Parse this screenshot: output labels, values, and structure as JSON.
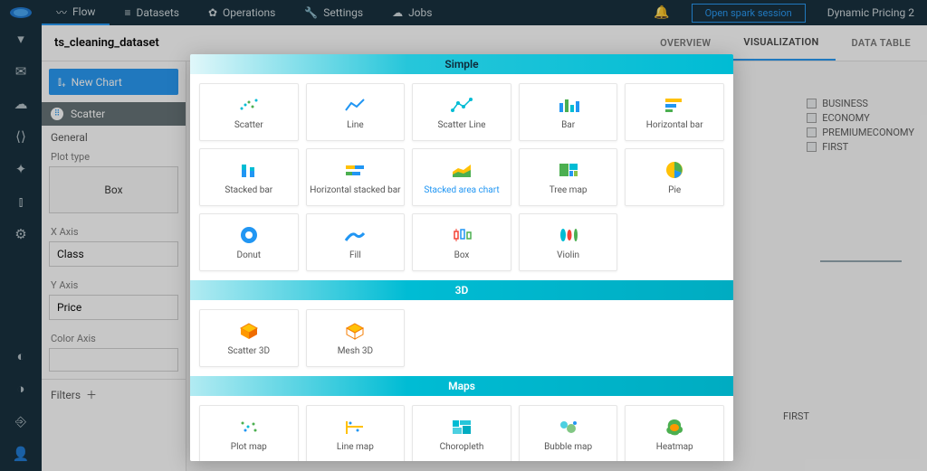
{
  "nav": {
    "items": [
      "Flow",
      "Datasets",
      "Operations",
      "Settings",
      "Jobs"
    ],
    "open_spark": "Open spark session",
    "project": "Dynamic Pricing 2"
  },
  "dataset": {
    "title": "ts_cleaning_dataset",
    "tabs": [
      "OVERVIEW",
      "VISUALIZATION",
      "DATA TABLE"
    ]
  },
  "config": {
    "new_chart": "New Chart",
    "type": "Scatter",
    "general": "General",
    "plot_type_label": "Plot type",
    "plot_type": "Box",
    "x_label": "X Axis",
    "x_value": "Class",
    "y_label": "Y Axis",
    "y_value": "Price",
    "color_label": "Color Axis",
    "filters": "Filters"
  },
  "legend": [
    "BUSINESS",
    "ECONOMY",
    "PREMIUMECONOMY",
    "FIRST"
  ],
  "chart_xlabel": "FIRST",
  "modal": {
    "sections": {
      "simple": "Simple",
      "threed": "3D",
      "maps": "Maps"
    },
    "simple": [
      {
        "id": "scatter",
        "label": "Scatter"
      },
      {
        "id": "line",
        "label": "Line"
      },
      {
        "id": "scatter-line",
        "label": "Scatter Line"
      },
      {
        "id": "bar",
        "label": "Bar"
      },
      {
        "id": "hbar",
        "label": "Horizontal bar"
      },
      {
        "id": "stacked-bar",
        "label": "Stacked bar"
      },
      {
        "id": "hstacked-bar",
        "label": "Horizontal stacked bar"
      },
      {
        "id": "stacked-area",
        "label": "Stacked area chart",
        "selected": true
      },
      {
        "id": "treemap",
        "label": "Tree map"
      },
      {
        "id": "pie",
        "label": "Pie"
      },
      {
        "id": "donut",
        "label": "Donut"
      },
      {
        "id": "fill",
        "label": "Fill"
      },
      {
        "id": "box",
        "label": "Box"
      },
      {
        "id": "violin",
        "label": "Violin"
      }
    ],
    "threed": [
      {
        "id": "scatter3d",
        "label": "Scatter 3D"
      },
      {
        "id": "mesh3d",
        "label": "Mesh 3D"
      }
    ],
    "maps": [
      {
        "id": "plotmap",
        "label": "Plot map"
      },
      {
        "id": "linemap",
        "label": "Line map"
      },
      {
        "id": "choropleth",
        "label": "Choropleth"
      },
      {
        "id": "bubblemap",
        "label": "Bubble map"
      },
      {
        "id": "heatmap",
        "label": "Heatmap"
      }
    ]
  }
}
